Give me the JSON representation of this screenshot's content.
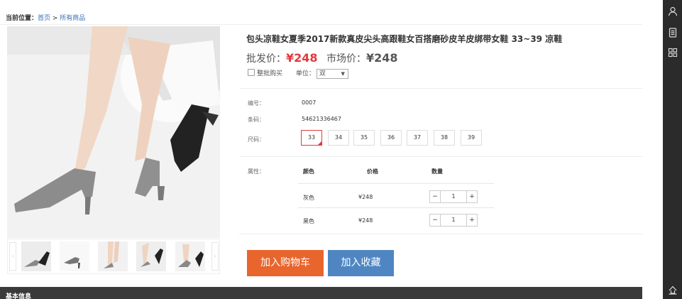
{
  "breadcrumb": {
    "label": "当前位置：",
    "home": "首页",
    "sep": " > ",
    "current": "所有商品"
  },
  "product": {
    "title": "包头凉鞋女夏季2017新款真皮尖头高跟鞋女百搭磨砂皮羊皮绑带女鞋 33~39 凉鞋",
    "wholesale_label": "批发价：",
    "wholesale_price": "¥248",
    "market_label": "市场价：",
    "market_price": "¥248",
    "batch_label": "整批购买",
    "unit_label": "单位：",
    "unit_value": "双",
    "code_label": "编号：",
    "code_value": "0007",
    "barcode_label": "条码：",
    "barcode_value": "54621336467",
    "size_label": "尺码：",
    "sizes": [
      "33",
      "34",
      "35",
      "36",
      "37",
      "38",
      "39"
    ],
    "selected_size": "33",
    "attr_label": "属性：",
    "table_headers": [
      "颜色",
      "价格",
      "数量"
    ],
    "variants": [
      {
        "color": "灰色",
        "price": "¥248",
        "qty": "1"
      },
      {
        "color": "黑色",
        "price": "¥248",
        "qty": "1"
      }
    ],
    "add_cart": "加入购物车",
    "add_fav": "加入收藏"
  },
  "stepper": {
    "minus": "−",
    "plus": "+"
  },
  "gallery": {
    "prev": "‹",
    "next": "›"
  },
  "base_info_label": "基本信息",
  "colors": {
    "accent_red": "#e4393c",
    "cart_orange": "#e8652d",
    "fav_blue": "#4f86c2"
  },
  "right_toolbar": [
    "user-icon",
    "document-icon",
    "qr-icon",
    "back-to-top-icon"
  ]
}
